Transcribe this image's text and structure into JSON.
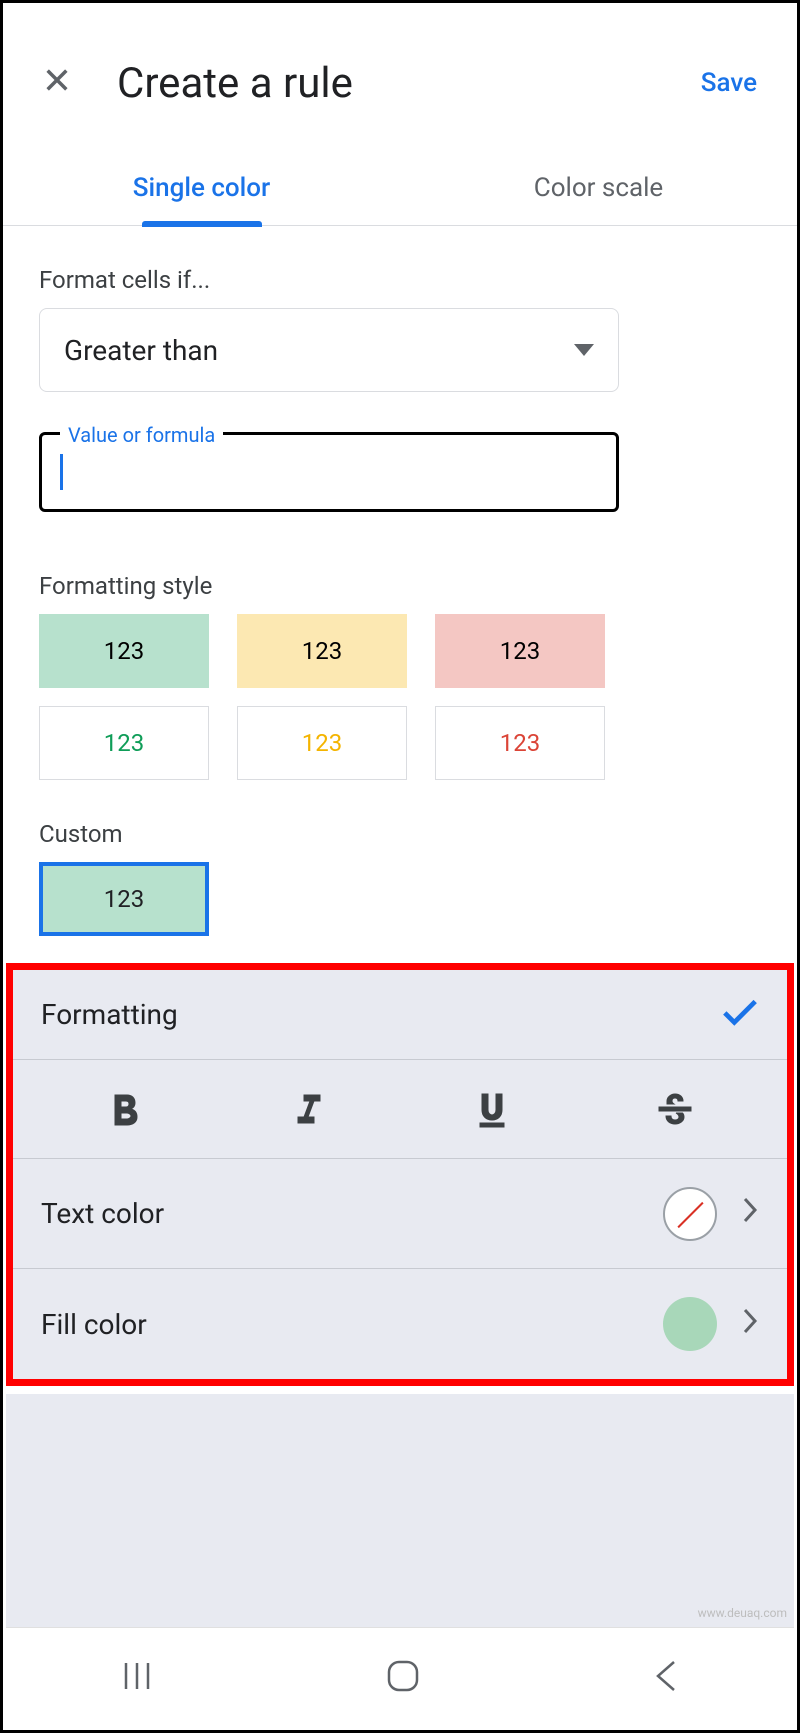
{
  "header": {
    "title": "Create a rule",
    "save": "Save"
  },
  "tabs": {
    "single": "Single color",
    "scale": "Color scale"
  },
  "condition": {
    "label": "Format cells if...",
    "selected": "Greater than",
    "value_placeholder": "Value or formula"
  },
  "style": {
    "label": "Formatting style",
    "swatch_text": "123",
    "custom_label": "Custom",
    "custom_swatch_text": "123"
  },
  "panel": {
    "formatting": "Formatting",
    "text_color": "Text color",
    "fill_color": "Fill color"
  },
  "watermark": "www.deuaq.com"
}
